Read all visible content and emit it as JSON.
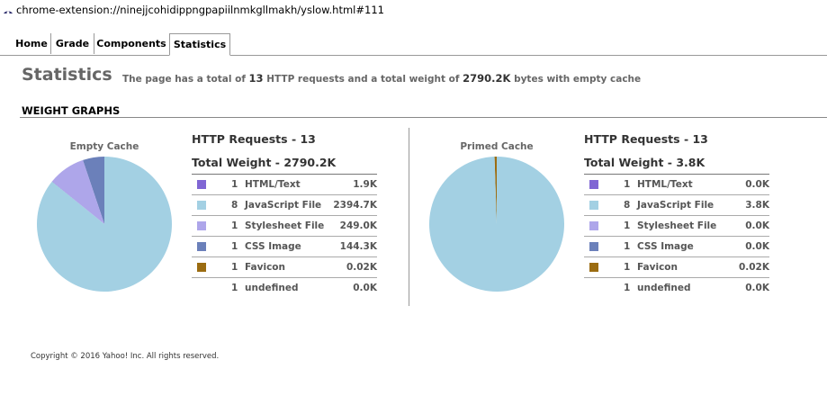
{
  "browser": {
    "url": "chrome-extension://ninejjcohidippngpapiilnmkgllmakh/yslow.html#111"
  },
  "tabs": [
    {
      "label": "Home"
    },
    {
      "label": "Grade"
    },
    {
      "label": "Components"
    },
    {
      "label": "Statistics",
      "active": true
    }
  ],
  "page": {
    "title": "Statistics",
    "summary_pre": "The page has a total of",
    "summary_requests": "13",
    "summary_mid": "HTTP requests and a total weight of",
    "summary_weight": "2790.2K",
    "summary_post": "bytes with empty cache",
    "section_title": "WEIGHT GRAPHS"
  },
  "colors": {
    "html": "#8066d4",
    "javascript": "#a3d0e3",
    "stylesheet": "#aea6ea",
    "css_image": "#6b80ba",
    "favicon": "#9b6c11"
  },
  "empty_cache": {
    "label": "Empty Cache",
    "requests_heading": "HTTP Requests - 13",
    "weight_heading": "Total Weight - 2790.2K",
    "rows": [
      {
        "count": "1",
        "type": "HTML/Text",
        "size": "1.9K",
        "color_key": "html"
      },
      {
        "count": "8",
        "type": "JavaScript File",
        "size": "2394.7K",
        "color_key": "javascript"
      },
      {
        "count": "1",
        "type": "Stylesheet File",
        "size": "249.0K",
        "color_key": "stylesheet"
      },
      {
        "count": "1",
        "type": "CSS Image",
        "size": "144.3K",
        "color_key": "css_image"
      },
      {
        "count": "1",
        "type": "Favicon",
        "size": "0.02K",
        "color_key": "favicon"
      },
      {
        "count": "1",
        "type": "undefined",
        "size": "0.0K",
        "color_key": ""
      }
    ]
  },
  "primed_cache": {
    "label": "Primed Cache",
    "requests_heading": "HTTP Requests - 13",
    "weight_heading": "Total Weight - 3.8K",
    "rows": [
      {
        "count": "1",
        "type": "HTML/Text",
        "size": "0.0K",
        "color_key": "html"
      },
      {
        "count": "8",
        "type": "JavaScript File",
        "size": "3.8K",
        "color_key": "javascript"
      },
      {
        "count": "1",
        "type": "Stylesheet File",
        "size": "0.0K",
        "color_key": "stylesheet"
      },
      {
        "count": "1",
        "type": "CSS Image",
        "size": "0.0K",
        "color_key": "css_image"
      },
      {
        "count": "1",
        "type": "Favicon",
        "size": "0.02K",
        "color_key": "favicon"
      },
      {
        "count": "1",
        "type": "undefined",
        "size": "0.0K",
        "color_key": ""
      }
    ]
  },
  "chart_data": [
    {
      "type": "pie",
      "title": "Empty Cache",
      "categories": [
        "HTML/Text",
        "JavaScript File",
        "Stylesheet File",
        "CSS Image",
        "Favicon"
      ],
      "values": [
        1.9,
        2394.7,
        249.0,
        144.3,
        0.02
      ],
      "colors": [
        "#8066d4",
        "#a3d0e3",
        "#aea6ea",
        "#6b80ba",
        "#9b6c11"
      ]
    },
    {
      "type": "pie",
      "title": "Primed Cache",
      "categories": [
        "HTML/Text",
        "JavaScript File",
        "Stylesheet File",
        "CSS Image",
        "Favicon"
      ],
      "values": [
        0.0,
        3.8,
        0.0,
        0.0,
        0.02
      ],
      "colors": [
        "#8066d4",
        "#a3d0e3",
        "#aea6ea",
        "#6b80ba",
        "#9b6c11"
      ]
    }
  ],
  "footer": {
    "copyright": "Copyright © 2016 Yahoo! Inc. All rights reserved."
  }
}
